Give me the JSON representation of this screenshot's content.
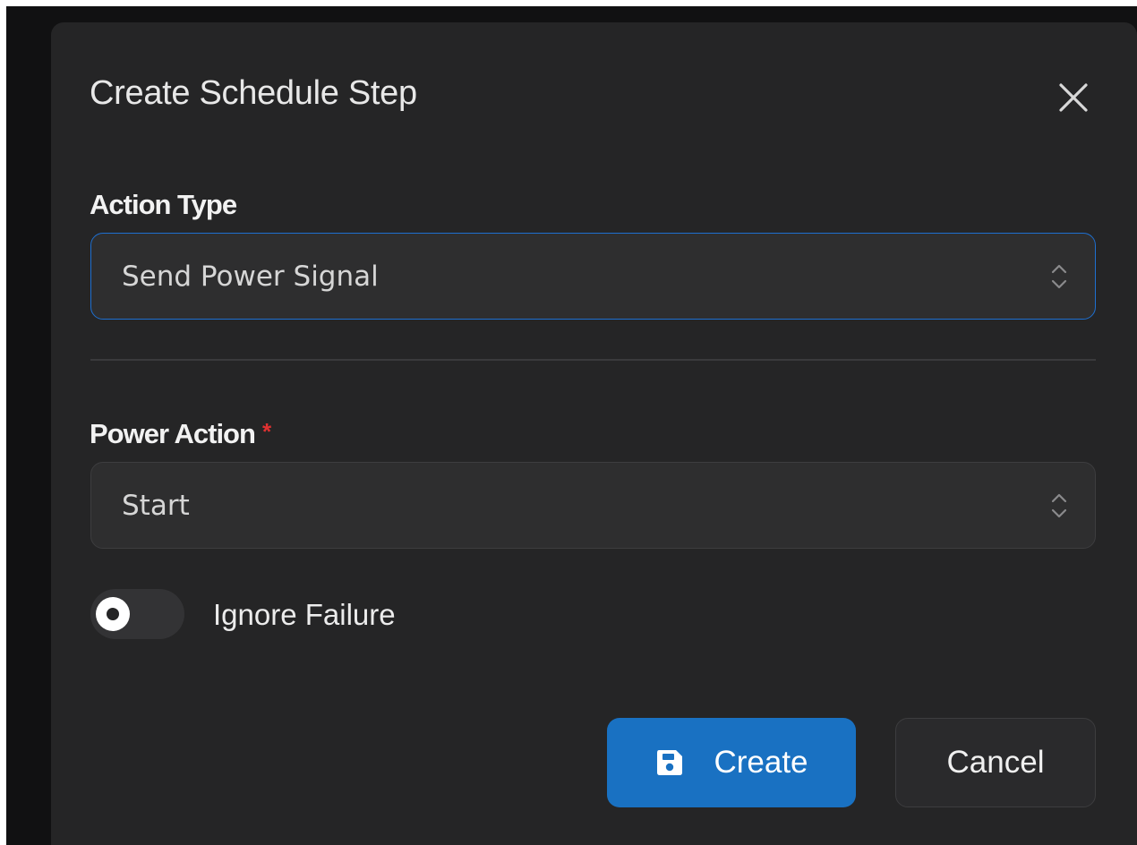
{
  "dialog": {
    "title": "Create Schedule Step",
    "close_icon": "close-icon"
  },
  "action_type": {
    "label": "Action Type",
    "value": "Send Power Signal",
    "icon": "chevron-up-down-icon"
  },
  "power_action": {
    "label": "Power Action",
    "required_marker": "*",
    "value": "Start",
    "icon": "chevron-up-down-icon"
  },
  "ignore_failure": {
    "label": "Ignore Failure",
    "checked": false
  },
  "buttons": {
    "create_label": "Create",
    "create_icon": "save-icon",
    "cancel_label": "Cancel"
  },
  "colors": {
    "backdrop": "#111112",
    "surface": "#252526",
    "accent": "#1971c2",
    "focus_border": "#1e6fd0",
    "required": "#e03131"
  }
}
